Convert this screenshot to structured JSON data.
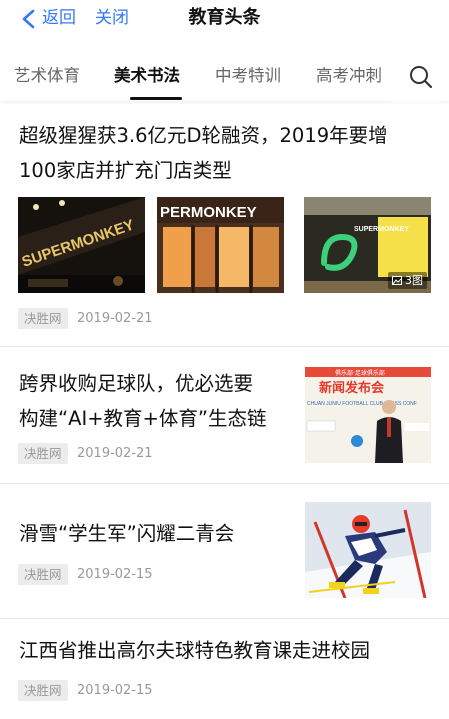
{
  "topbar": {
    "back_label": "返回",
    "close_label": "关闭",
    "title": "教育头条",
    "accent_color": "#3478f6"
  },
  "tabs": [
    {
      "label": "艺术体育",
      "active": false
    },
    {
      "label": "美术书法",
      "active": true
    },
    {
      "label": "中考特训",
      "active": false
    },
    {
      "label": "高考冲刺",
      "active": false
    }
  ],
  "search_icon": "search-icon",
  "articles": [
    {
      "title_line1": "超级猩猩获3.6亿元D轮融资，2019年要增",
      "title_line2": "100家店并扩充门店类型",
      "images": [
        {
          "text": "SUPERMONKEY",
          "desc": "store-sign"
        },
        {
          "text": "PERMONKEY",
          "desc": "storefront"
        },
        {
          "text": "SUPERMONKEY",
          "desc": "gym-interior"
        }
      ],
      "image_count": "3图",
      "source": "决胜网",
      "date": "2019-02-21"
    },
    {
      "title_line1": "跨界收购足球队，优必选要",
      "title_line2": "构建“AI+教育+体育”生态链",
      "thumb": {
        "banner": "新闻发布会",
        "sub": "CHUAN JUNIU FOOTBALL CLUB PRESS CONF",
        "top": "俱乐部·足球俱乐部"
      },
      "source": "决胜网",
      "date": "2019-02-21"
    },
    {
      "title_line1": "滑雪“学生军”闪耀二青会",
      "thumb": {
        "desc": "slalom-skier"
      },
      "source": "决胜网",
      "date": "2019-02-15"
    },
    {
      "title_line1": "江西省推出高尔夫球特色教育课走进校园",
      "source": "决胜网",
      "date": "2019-02-15"
    }
  ]
}
